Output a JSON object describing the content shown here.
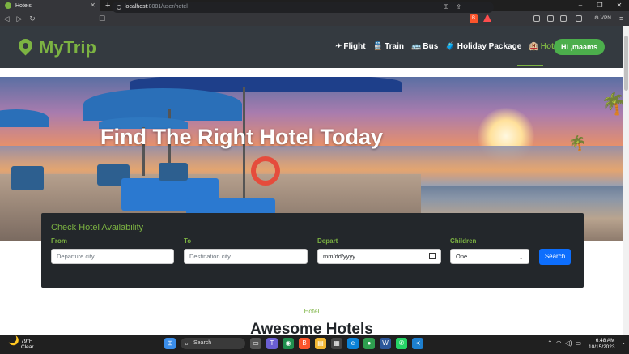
{
  "browser": {
    "tab_title": "Hotels",
    "new_tab": "+",
    "url_host": "localhost",
    "url_path": ":8081/user/hotel",
    "vpn_label": "VPN",
    "window_controls": [
      "–",
      "❐",
      "✕"
    ]
  },
  "navbar": {
    "brand": "MyTrip",
    "links": [
      {
        "label": "Flight",
        "icon": "✈"
      },
      {
        "label": "Train",
        "icon": "🚆"
      },
      {
        "label": "Bus",
        "icon": "🚌"
      },
      {
        "label": "Holiday Package",
        "icon": "🧳"
      },
      {
        "label": "Hotel",
        "icon": "🏨"
      }
    ],
    "user_button": "Hi ,maams",
    "accent_color": "#7cb342"
  },
  "hero": {
    "title": "Find The Right Hotel Today"
  },
  "search_form": {
    "title": "Check Hotel Availability",
    "from_label": "From",
    "from_placeholder": "Departure city",
    "to_label": "To",
    "to_placeholder": "Destination city",
    "depart_label": "Depart",
    "depart_value": "mm/dd/yyyy",
    "children_label": "Children",
    "children_value": "One",
    "search_button": "Search"
  },
  "section": {
    "label": "Hotel",
    "heading": "Awesome Hotels"
  },
  "taskbar": {
    "weather_temp": "79°F",
    "weather_desc": "Clear",
    "search_label": "Search",
    "time": "6:48 AM",
    "date": "10/15/2023"
  }
}
